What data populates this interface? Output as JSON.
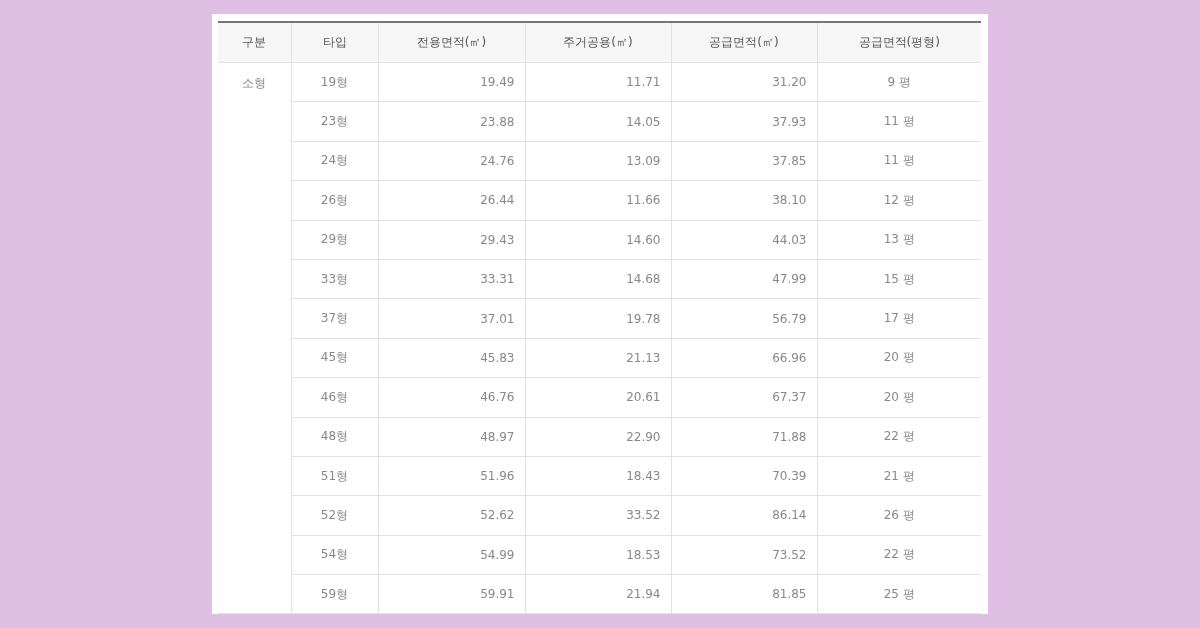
{
  "table": {
    "columns": [
      "구분",
      "타입",
      "전용면적(㎡)",
      "주거공용(㎡)",
      "공급면적(㎡)",
      "공급면적(평형)"
    ],
    "groups": [
      {
        "label": "소형",
        "rows": [
          [
            "19형",
            "19.49",
            "11.71",
            "31.20",
            "9 평"
          ],
          [
            "23형",
            "23.88",
            "14.05",
            "37.93",
            "11 평"
          ],
          [
            "24형",
            "24.76",
            "13.09",
            "37.85",
            "11 평"
          ],
          [
            "26형",
            "26.44",
            "11.66",
            "38.10",
            "12 평"
          ],
          [
            "29형",
            "29.43",
            "14.60",
            "44.03",
            "13 평"
          ],
          [
            "33형",
            "33.31",
            "14.68",
            "47.99",
            "15 평"
          ],
          [
            "37형",
            "37.01",
            "19.78",
            "56.79",
            "17 평"
          ],
          [
            "45형",
            "45.83",
            "21.13",
            "66.96",
            "20 평"
          ],
          [
            "46형",
            "46.76",
            "20.61",
            "67.37",
            "20 평"
          ],
          [
            "48형",
            "48.97",
            "22.90",
            "71.88",
            "22 평"
          ],
          [
            "51형",
            "51.96",
            "18.43",
            "70.39",
            "21 평"
          ],
          [
            "52형",
            "52.62",
            "33.52",
            "86.14",
            "26 평"
          ],
          [
            "54형",
            "54.99",
            "18.53",
            "73.52",
            "22 평"
          ],
          [
            "59형",
            "59.91",
            "21.94",
            "81.85",
            "25 평"
          ]
        ]
      }
    ]
  }
}
